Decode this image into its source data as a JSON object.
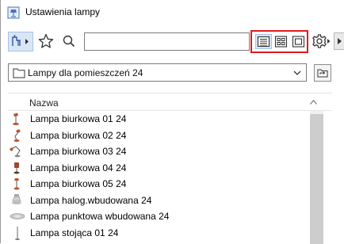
{
  "window": {
    "title": "Ustawienia lampy"
  },
  "toolbar": {
    "library_button_icon": "library-object-icon",
    "favorites_icon": "star-icon",
    "search_icon": "search-icon",
    "search_value": "",
    "view_modes": [
      {
        "icon": "list-view-icon",
        "active": true
      },
      {
        "icon": "grid-view-icon",
        "active": false
      },
      {
        "icon": "preview-view-icon",
        "active": false
      }
    ],
    "settings_icon": "gear-icon"
  },
  "folder": {
    "selected": "Lampy dla pomieszczeń 24",
    "up_icon": "folder-up-icon"
  },
  "list": {
    "column_header": "Nazwa",
    "items": [
      {
        "label": "Lampa biurkowa 01 24",
        "thumb": "desk-lamp-icon"
      },
      {
        "label": "Lampa biurkowa 02 24",
        "thumb": "desk-lamp-icon"
      },
      {
        "label": "Lampa biurkowa 03 24",
        "thumb": "desk-lamp-icon"
      },
      {
        "label": "Lampa biurkowa 04 24",
        "thumb": "desk-lamp-icon"
      },
      {
        "label": "Lampa biurkowa 05 24",
        "thumb": "desk-lamp-icon"
      },
      {
        "label": "Lampa halog.wbudowana 24",
        "thumb": "recessed-halogen-icon"
      },
      {
        "label": "Lampa punktowa wbudowana 24",
        "thumb": "recessed-spot-icon"
      },
      {
        "label": "Lampa stojąca 01 24",
        "thumb": "floor-lamp-icon"
      }
    ]
  },
  "colors": {
    "highlight_border": "#e0191f",
    "active_button": "#d9e6f5",
    "lamp_shade": "#b5532e"
  }
}
